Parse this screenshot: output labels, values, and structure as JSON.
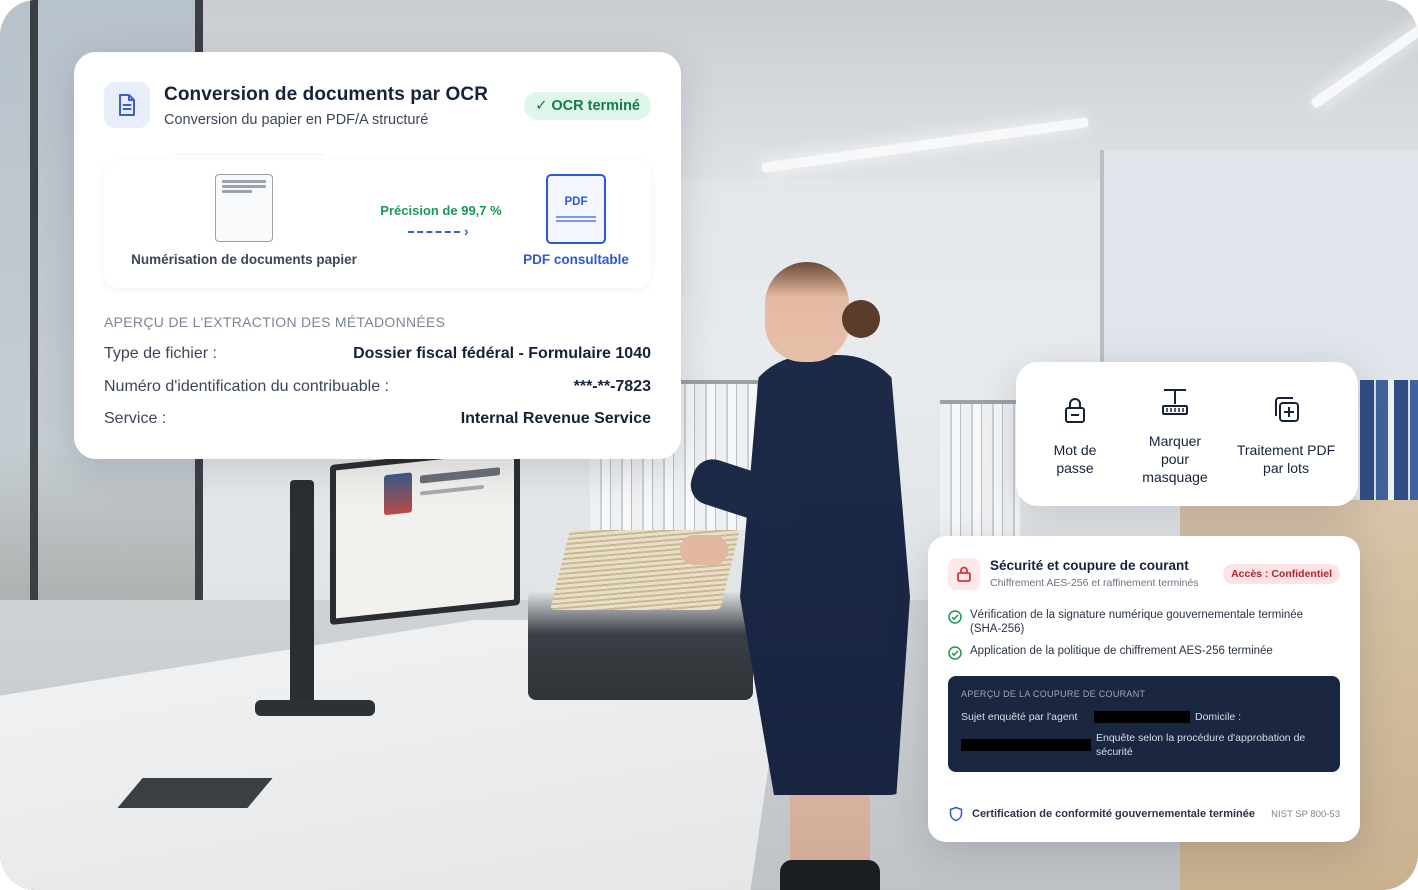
{
  "ocr_card": {
    "title": "Conversion de documents par OCR",
    "subtitle": "Conversion du papier en PDF/A structuré",
    "status_badge": "✓ OCR terminé",
    "flow": {
      "source_label": "Numérisation de documents papier",
      "accuracy": "Précision de 99,7 %",
      "pdf_icon_text": "PDF",
      "target_label": "PDF consultable"
    },
    "metadata": {
      "heading": "APERÇU DE L'EXTRACTION DES MÉTADONNÉES",
      "rows": [
        {
          "label": "Type de fichier :",
          "value": "Dossier fiscal fédéral - Formulaire 1040"
        },
        {
          "label": "Numéro d'identification du contribuable :",
          "value": "***-**-7823"
        },
        {
          "label": "Service :",
          "value": "Internal Revenue Service"
        }
      ]
    }
  },
  "tools_card": {
    "tools": [
      {
        "label_line1": "Mot de",
        "label_line2": "passe",
        "label_line3": "",
        "icon": "lock-icon"
      },
      {
        "label_line1": "Marquer",
        "label_line2": "pour",
        "label_line3": "masquage",
        "icon": "redact-tool-icon"
      },
      {
        "label_line1": "Traitement PDF",
        "label_line2": "par lots",
        "label_line3": "",
        "icon": "batch-add-icon"
      }
    ]
  },
  "security_card": {
    "title": "Sécurité et coupure de courant",
    "subtitle": "Chiffrement AES-256 et raffinement terminés",
    "access_badge": "Accès : Confidentiel",
    "checks": [
      {
        "line1": "Vérification de la signature numérique gouvernementale terminée",
        "line2": "(SHA-256)"
      },
      {
        "line1": "Application de la politique de chiffrement AES-256 terminée",
        "line2": ""
      }
    ],
    "preview": {
      "heading": "APERÇU DE LA COUPURE DE COURANT",
      "subject_label": "Sujet enquêté par l'agent",
      "domicile_label": "Domicile :",
      "procedure_line1": "Enquête selon la procédure d'approbation de",
      "procedure_line2": "sécurité"
    },
    "footer": {
      "text": "Certification de conformité gouvernementale terminée",
      "code": "NIST SP 800-53"
    }
  },
  "colors": {
    "brand_blue": "#2e59d4",
    "success_green": "#179a52",
    "danger_red": "#b4232c",
    "dark_panel": "#1b2740"
  }
}
